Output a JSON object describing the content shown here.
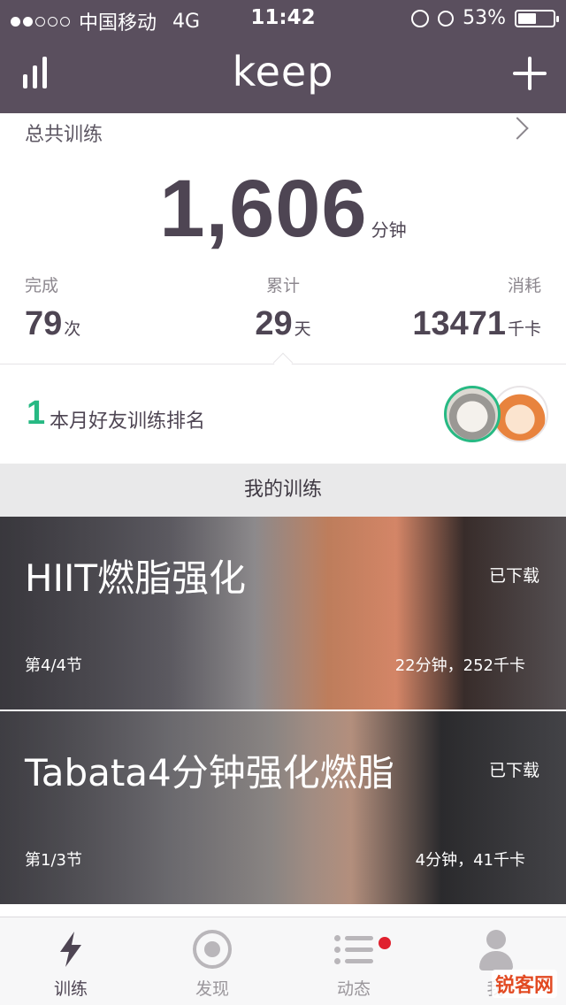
{
  "status_bar": {
    "carrier": "中国移动",
    "network": "4G",
    "time": "11:42",
    "battery": "53%",
    "battery_level": 0.53
  },
  "navbar": {
    "title": "keep",
    "left_icon": "stats-icon",
    "right_icon": "plus-icon"
  },
  "summary": {
    "label": "总共训练",
    "total": "1,606",
    "total_unit": "分钟",
    "stats": [
      {
        "label": "完成",
        "value": "79",
        "unit": "次"
      },
      {
        "label": "累计",
        "value": "29",
        "unit": "天"
      },
      {
        "label": "消耗",
        "value": "13471",
        "unit": "千卡"
      }
    ]
  },
  "friends": {
    "rank": "1",
    "text": "本月好友训练排名"
  },
  "my_training": {
    "title": "我的训练",
    "cards": [
      {
        "title": "HIIT燃脂强化",
        "status": "已下载",
        "section": "第4/4节",
        "meta": "22分钟，252千卡"
      },
      {
        "title": "Tabata4分钟强化燃脂",
        "status": "已下载",
        "section": "第1/3节",
        "meta": "4分钟，41千卡"
      }
    ]
  },
  "tabs": [
    {
      "label": "训练",
      "icon": "bolt-icon",
      "active": true
    },
    {
      "label": "发现",
      "icon": "target-icon",
      "active": false
    },
    {
      "label": "动态",
      "icon": "feed-icon",
      "active": false,
      "badge": true
    },
    {
      "label": "我",
      "icon": "person-icon",
      "active": false
    }
  ],
  "watermark": "锐客网",
  "colors": {
    "header": "#5a4f5e",
    "accent": "#27b983",
    "badge": "#e0202e"
  }
}
